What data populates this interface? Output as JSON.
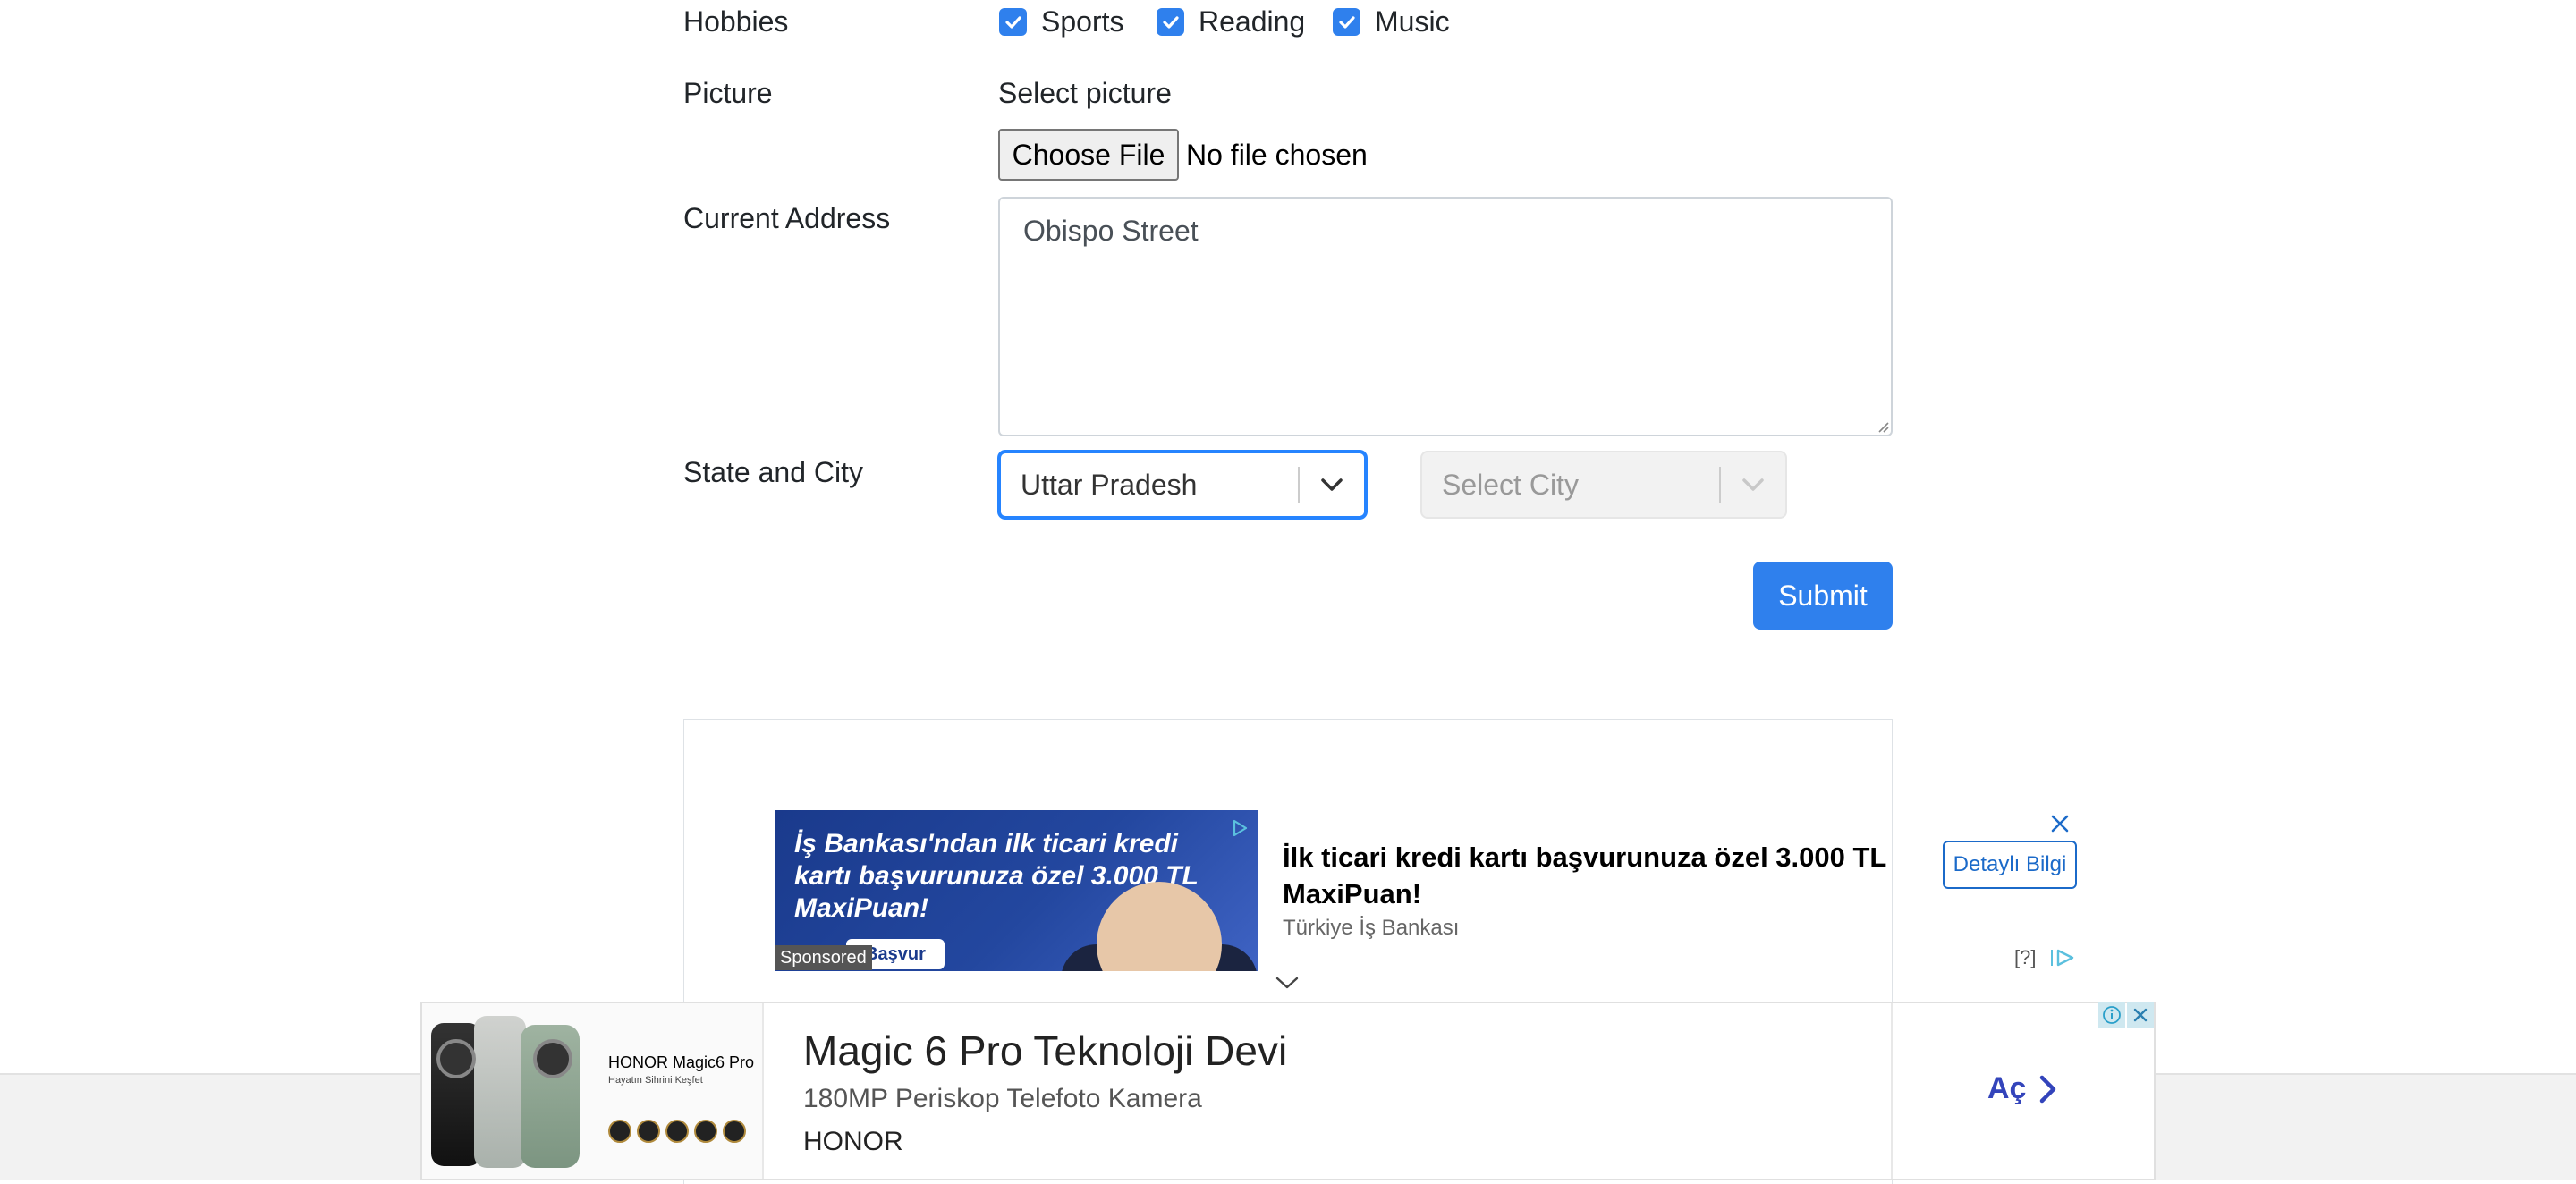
{
  "form": {
    "hobbies": {
      "label": "Hobbies",
      "options": [
        {
          "label": "Sports",
          "checked": true
        },
        {
          "label": "Reading",
          "checked": true
        },
        {
          "label": "Music",
          "checked": true
        }
      ]
    },
    "picture": {
      "label": "Picture",
      "hint": "Select picture",
      "button": "Choose File",
      "status": "No file chosen"
    },
    "address": {
      "label": "Current Address",
      "value": "Obispo Street"
    },
    "state_city": {
      "label": "State and City",
      "state_value": "Uttar Pradesh",
      "city_placeholder": "Select City"
    },
    "submit_label": "Submit"
  },
  "native_ad": {
    "image_headline": "İş Bankası'ndan ilk ticari kredi kartı başvurunuza özel 3.000 TL MaxiPuan!",
    "image_cta": "Başvur",
    "sponsored": "Sponsored",
    "title": "İlk ticari kredi kartı başvurunuza özel 3.000 TL MaxiPuan!",
    "advertiser": "Türkiye İş Bankası",
    "cta": "Detaylı Bilgi",
    "help": "[?]"
  },
  "bottom_ad": {
    "brand": "HONOR Magic6 Pro",
    "tagline": "Hayatın Sihrini Keşfet",
    "title": "Magic 6 Pro Teknoloji Devi",
    "subtitle": "180MP Periskop Telefoto Kamera",
    "advertiser": "HONOR",
    "cta": "Aç"
  },
  "colors": {
    "primary": "#2f80ed",
    "focus": "#2684ff",
    "ad_blue": "#1b6ac9",
    "cta_blue": "#3344bb"
  }
}
